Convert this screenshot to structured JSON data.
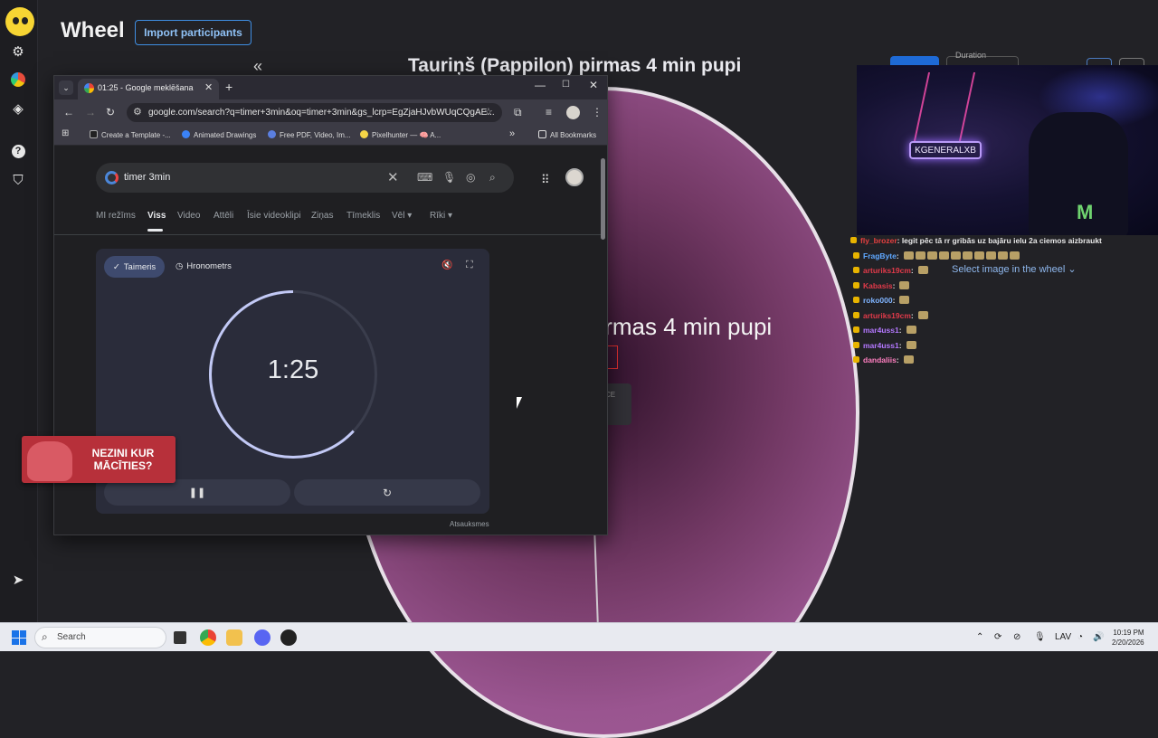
{
  "app": {
    "title": "Wheel",
    "import_label": "Import participants"
  },
  "wheel": {
    "title": "Tauriņš (Pappilon) pirmas 4 min pupi",
    "label": "pirmas 4 min pupi",
    "center_hint": "CE",
    "duration_label": "Duration",
    "select_image": "Select image in the wheel"
  },
  "browser": {
    "tab_title": "01:25 - Google meklēšana",
    "url": "google.com/search?q=timer+3min&oq=timer+3min&gs_lcrp=EgZjaHJvbWUqCQgAE...",
    "bookmarks": [
      "Create a Template -...",
      "Animated Drawings",
      "Free PDF, Video, Im...",
      "Pixelhunter — 🧠 A...",
      "All Bookmarks"
    ],
    "search_query": "timer 3min",
    "filters": [
      "MI režīms",
      "Viss",
      "Video",
      "Attēli",
      "Īsie videoklipi",
      "Ziņas",
      "Tīmeklis",
      "Vēl ▾",
      "Rīki ▾"
    ],
    "active_filter": "Viss"
  },
  "timer": {
    "tab_timer": "Taimeris",
    "tab_stopwatch": "Hronometrs",
    "time": "1:25",
    "pause": "❚❚",
    "reset": "↻",
    "feedback": "Atsauksmes",
    "remaining_fraction": 0.63
  },
  "stream": {
    "neon_text": "KGENERALXB",
    "monster": "M",
    "chat": [
      {
        "user": "fly_brozer",
        "color": "#e64040",
        "msg": ": legit pēc tā rr gribās uz bajāru ielu 2a ciemos aizbraukt",
        "emotes": 0
      },
      {
        "user": "FragByte",
        "color": "#5fa8ff",
        "msg": ":",
        "emotes": 10
      },
      {
        "user": "arturiks19cm",
        "color": "#e23a4a",
        "msg": ":",
        "emotes": 1
      },
      {
        "user": "Kabasis",
        "color": "#e23a4a",
        "msg": ":",
        "emotes": 1
      },
      {
        "user": "roko000",
        "color": "#7fb4ff",
        "msg": ":",
        "emotes": 1
      },
      {
        "user": "arturiks19cm",
        "color": "#e23a4a",
        "msg": ":",
        "emotes": 1
      },
      {
        "user": "mar4uss1",
        "color": "#b478ff",
        "msg": ":",
        "emotes": 1
      },
      {
        "user": "mar4uss1",
        "color": "#b478ff",
        "msg": ":",
        "emotes": 1
      },
      {
        "user": "dandaliis",
        "color": "#ff7fc0",
        "msg": ":",
        "emotes": 1
      }
    ]
  },
  "promo": {
    "line1": "NEZINI KUR",
    "line2": "MĀCĪTIES?"
  },
  "taskbar": {
    "search": "Search",
    "lang": "LAV",
    "time": "10:19 PM",
    "date": "2/20/2026"
  },
  "colors": {
    "accent": "#3f8ee2",
    "wheel": "#a15c97",
    "timer_ring": "#c2c9f5"
  }
}
